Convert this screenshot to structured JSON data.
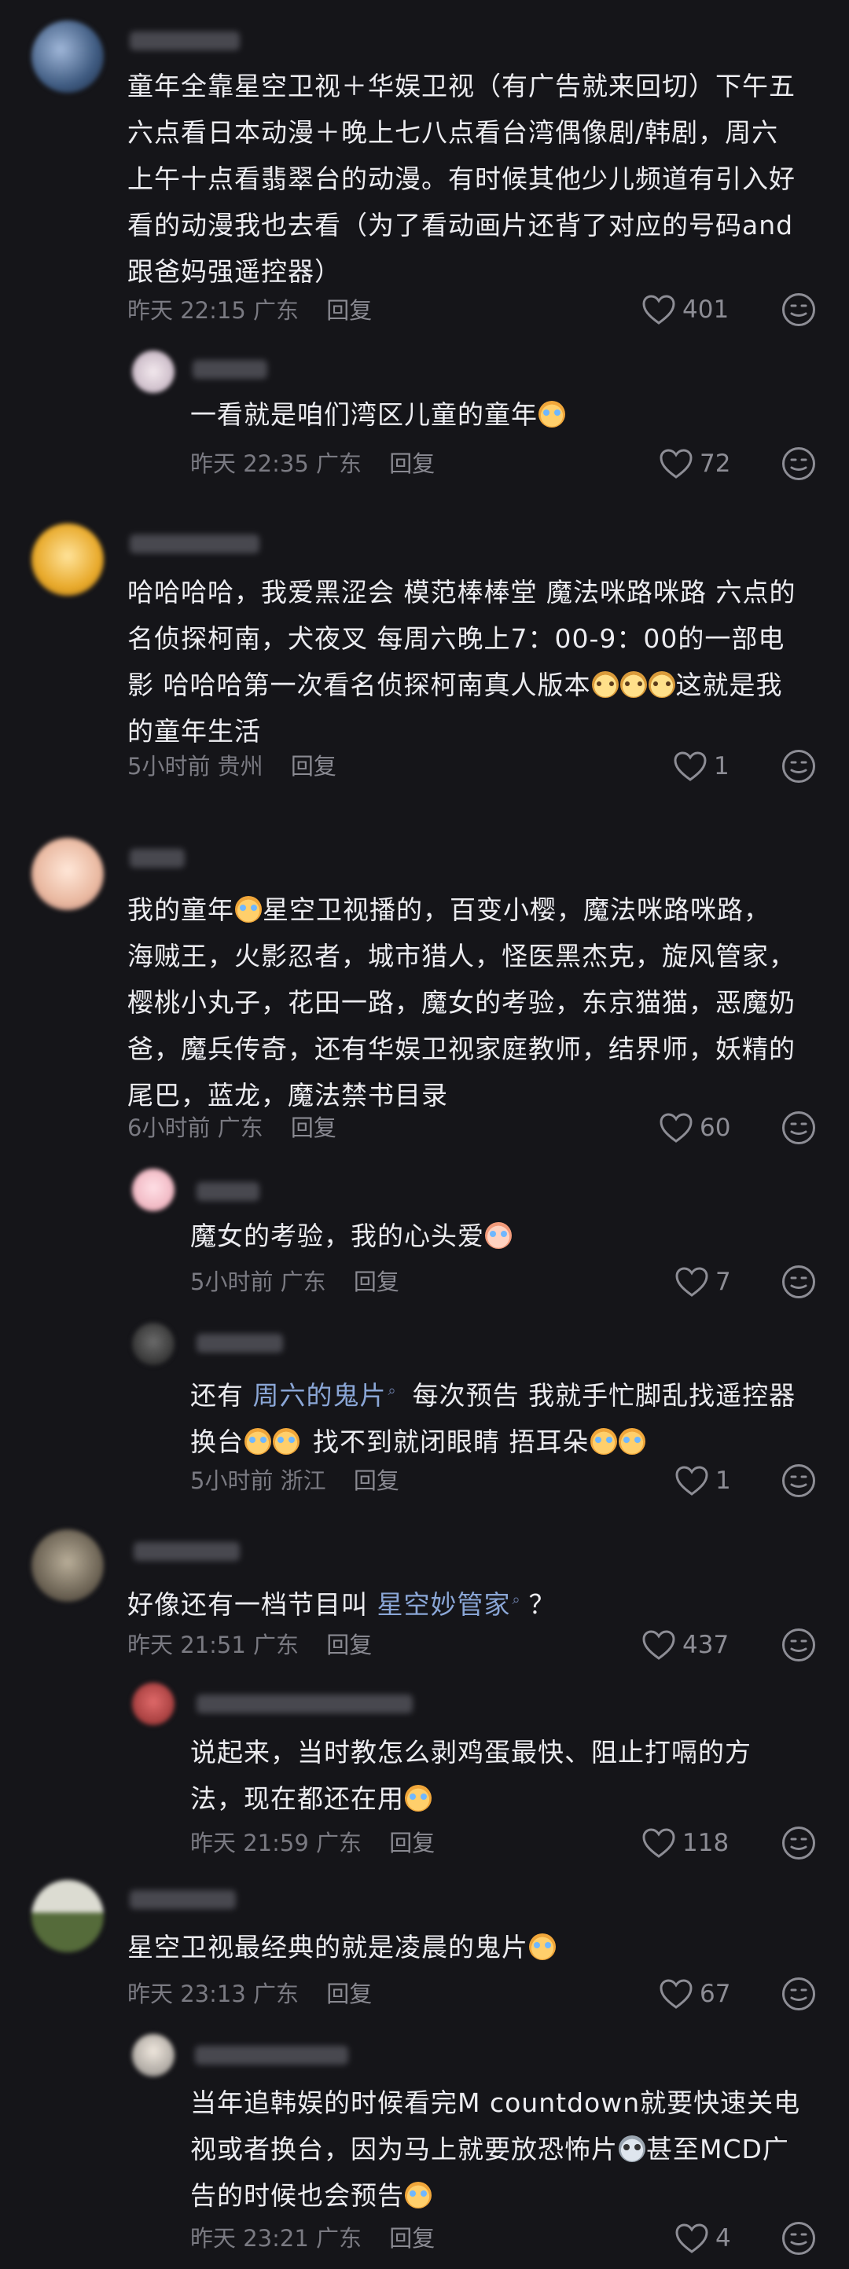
{
  "comments": [
    {
      "text_lines": [
        "童年全靠星空卫视＋华娱卫视（有广告就来回切）下午五",
        "六点看日本动漫＋晚上七八点看台湾偶像剧/韩剧，周六",
        "上午十点看翡翠台的动漫。有时候其他少儿频道有引入好",
        "看的动漫我也去看（为了看动画片还背了对应的号码and",
        "跟爸妈强遥控器）"
      ],
      "time": "昨天 22:15",
      "location": "广东",
      "reply": "回复",
      "likes": "401"
    },
    {
      "text_lines": [
        "一看就是咱们湾区儿童的童年"
      ],
      "time": "昨天 22:35",
      "location": "广东",
      "reply": "回复",
      "likes": "72"
    },
    {
      "text_lines": [
        "哈哈哈哈，我爱黑涩会 模范棒棒堂 魔法咪路咪路 六点的",
        "名侦探柯南，犬夜叉 每周六晚上7：00-9：00的一部电",
        "影 哈哈哈第一次看名侦探柯南真人版本",
        "的童年生活"
      ],
      "line3_suffix": "这就是我",
      "time": "5小时前",
      "location": "贵州",
      "reply": "回复",
      "likes": "1"
    },
    {
      "text_lines": [
        "我的童年",
        "星空卫视播的，百变小樱，魔法咪路咪路，",
        "海贼王，火影忍者，城市猎人，怪医黑杰克，旋风管家，",
        "樱桃小丸子，花田一路，魔女的考验，东京猫猫，恶魔奶",
        "爸，魔兵传奇，还有华娱卫视家庭教师，结界师，妖精的",
        "尾巴，蓝龙，魔法禁书目录"
      ],
      "time": "6小时前",
      "location": "广东",
      "reply": "回复",
      "likes": "60"
    },
    {
      "text_lines": [
        "魔女的考验，我的心头爱"
      ],
      "time": "5小时前",
      "location": "广东",
      "reply": "回复",
      "likes": "7"
    },
    {
      "prefix": "还有 ",
      "link": "周六的鬼片",
      "line1_rest": "每次预告 我就手忙脚乱找遥控器",
      "line2_a": "换台",
      "line2_b": "找不到就闭眼睛 捂耳朵",
      "time": "5小时前",
      "location": "浙江",
      "reply": "回复",
      "likes": "1"
    },
    {
      "prefix": "好像还有一档节目叫 ",
      "link": "星空妙管家",
      "suffix": "？",
      "time": "昨天 21:51",
      "location": "广东",
      "reply": "回复",
      "likes": "437"
    },
    {
      "text_lines": [
        "说起来，当时教怎么剥鸡蛋最快、阻止打嗝的方",
        "法，现在都还在用"
      ],
      "time": "昨天 21:59",
      "location": "广东",
      "reply": "回复",
      "likes": "118"
    },
    {
      "text_lines": [
        "星空卫视最经典的就是凌晨的鬼片"
      ],
      "time": "昨天 23:13",
      "location": "广东",
      "reply": "回复",
      "likes": "67"
    },
    {
      "text_lines": [
        "当年追韩娱的时候看完M countdown就要快速关电",
        "视或者换台，因为马上就要放恐怖片",
        "甚至MCD广",
        "告的时候也会预告"
      ],
      "time": "昨天 23:21",
      "location": "广东",
      "reply": "回复",
      "likes": "4"
    }
  ]
}
